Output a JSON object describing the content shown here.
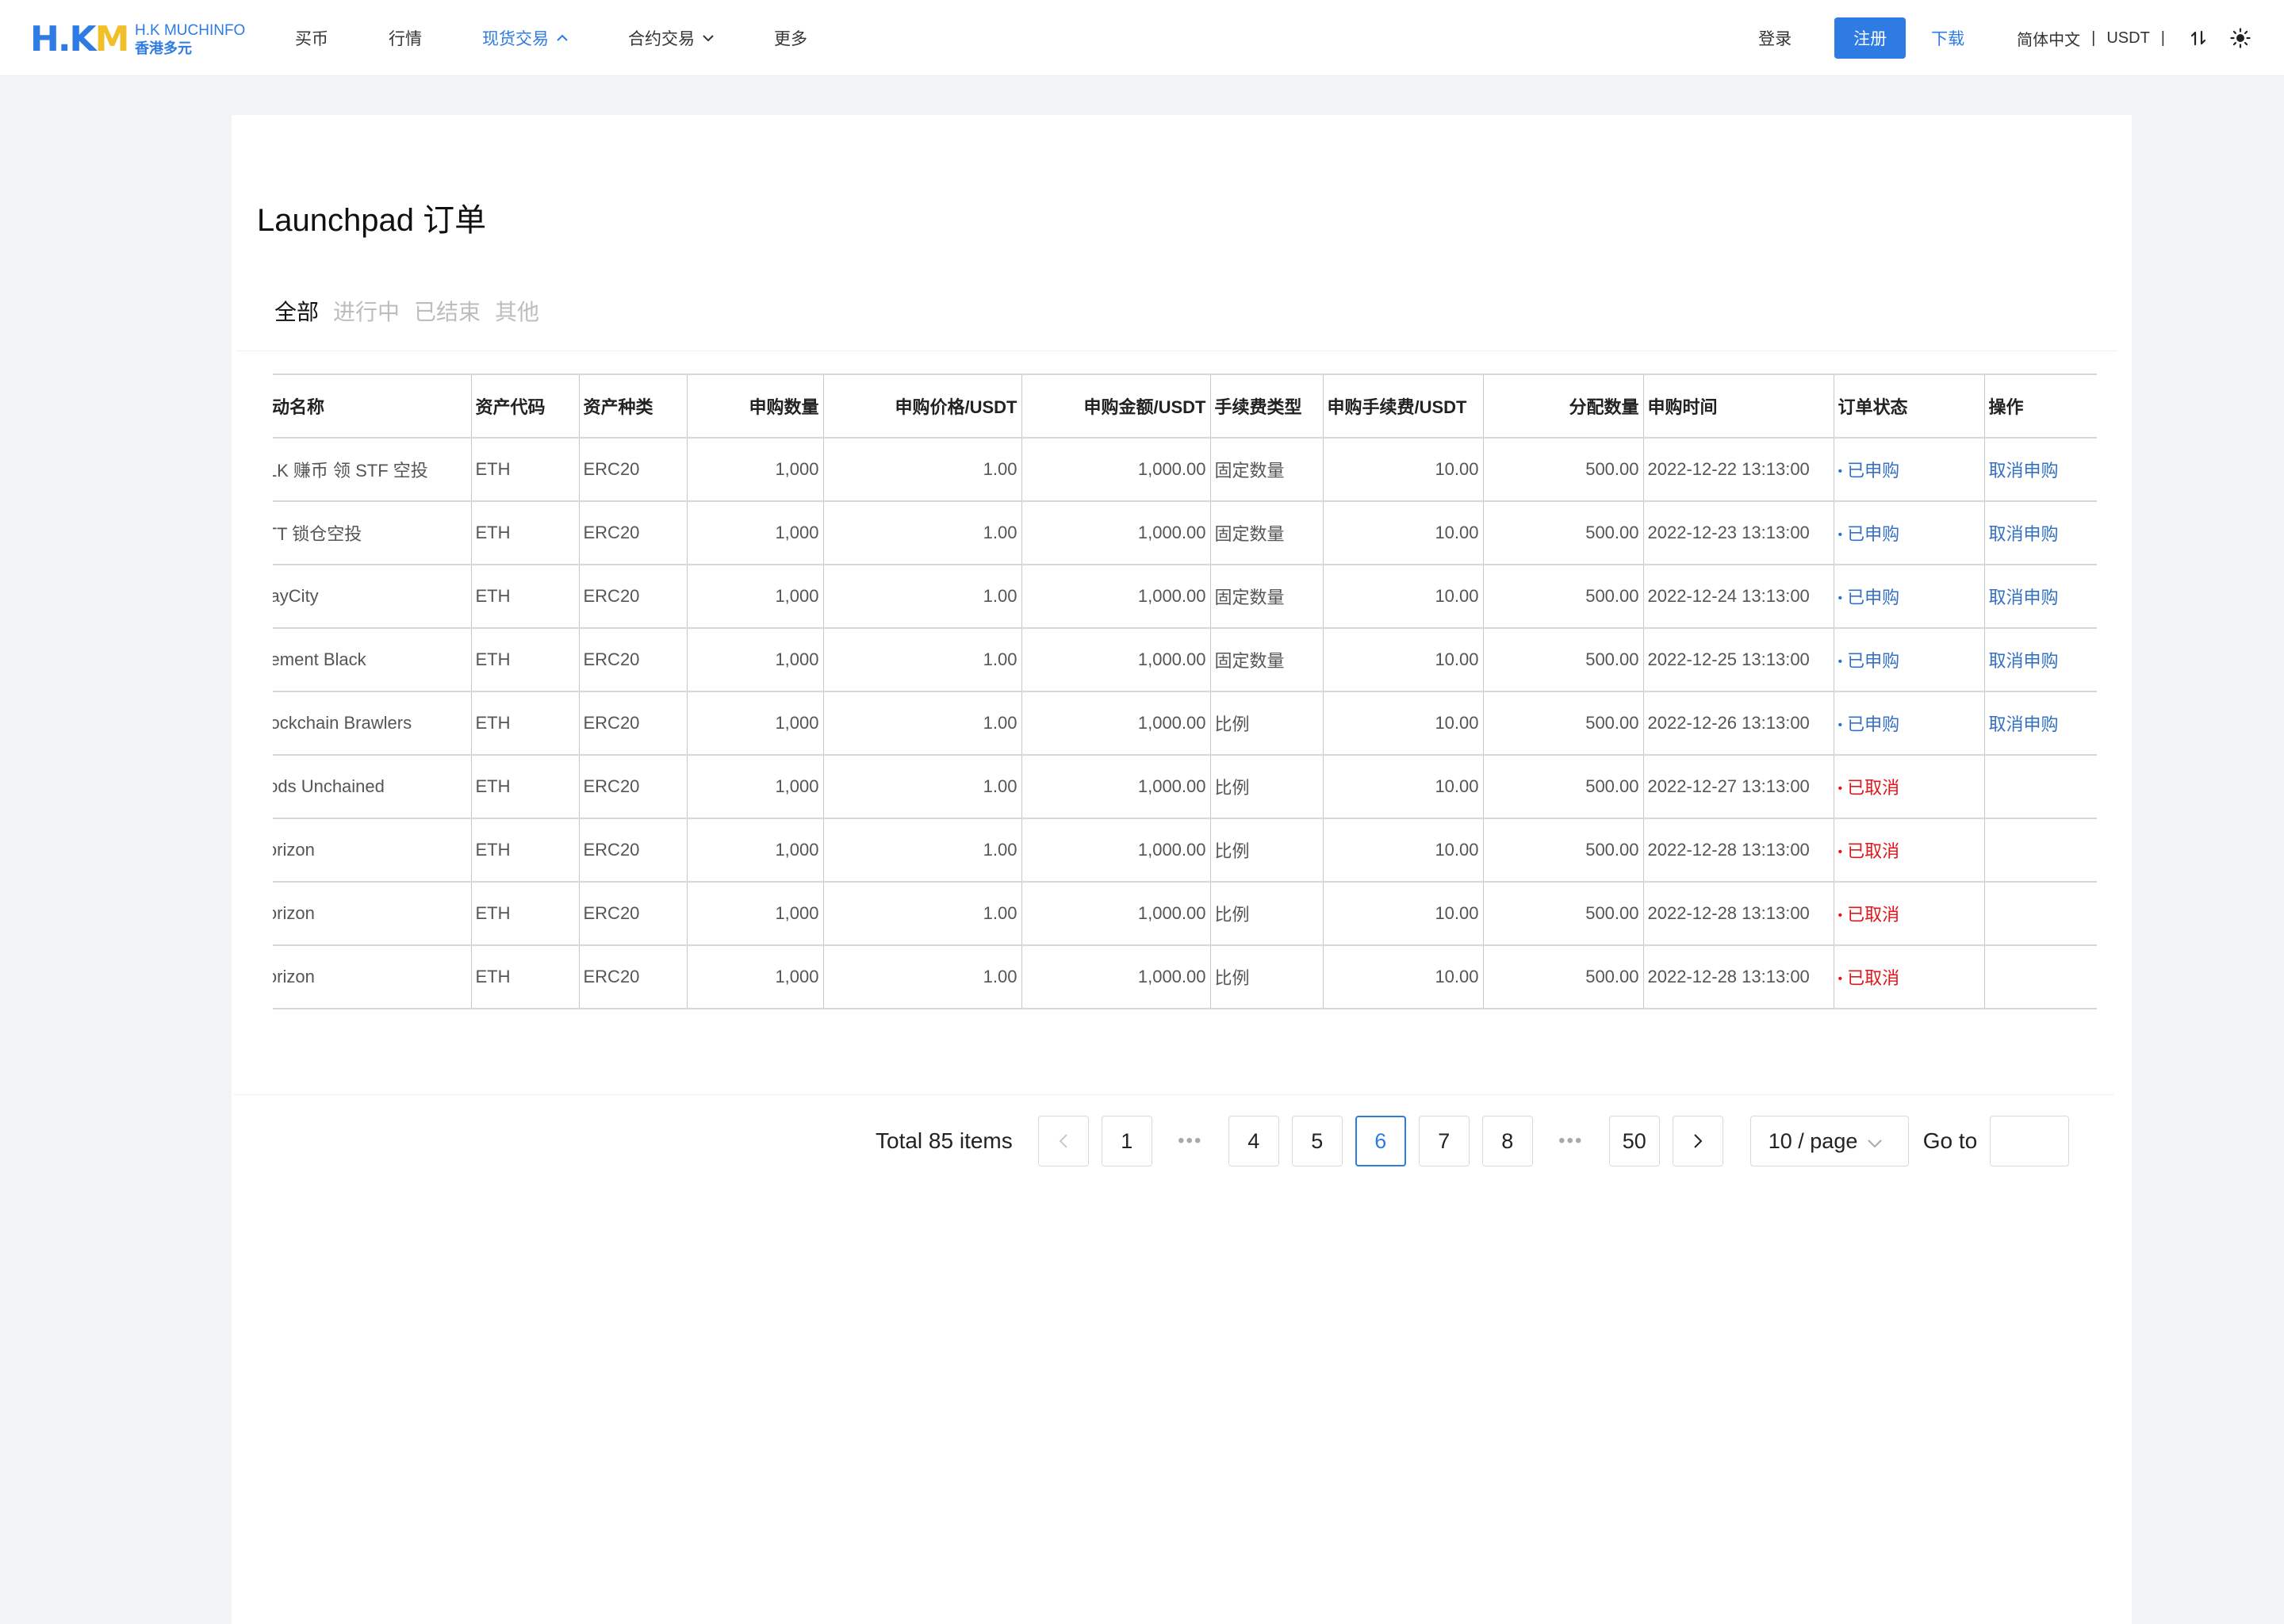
{
  "brand": {
    "mark_left": "H.K",
    "mark_right": "M",
    "name": "H.K MUCHINFO",
    "sub": "香港多元"
  },
  "nav": {
    "items": [
      {
        "label": "买币"
      },
      {
        "label": "行情"
      },
      {
        "label": "现货交易"
      },
      {
        "label": "合约交易"
      },
      {
        "label": "更多"
      }
    ],
    "login": "登录",
    "register": "注册",
    "download": "下载",
    "language": "简体中文",
    "currency": "USDT",
    "separator": "|"
  },
  "page": {
    "title": "Launchpad 订单"
  },
  "tabs": [
    {
      "label": "全部"
    },
    {
      "label": "进行中"
    },
    {
      "label": "已结束"
    },
    {
      "label": "其他"
    }
  ],
  "table": {
    "headers": [
      "活动名称",
      "资产代码",
      "资产种类",
      "申购数量",
      "申购价格/USDT",
      "申购金额/USDT",
      "手续费类型",
      "申购手续费/USDT",
      "分配数量",
      "申购时间",
      "订单状态",
      "操作"
    ],
    "rows": [
      {
        "name": "HLK 赚币 领 STF 空投",
        "code": "ETH",
        "type": "ERC20",
        "qty": "1,000",
        "price": "1.00",
        "amount": "1,000.00",
        "fee_type": "固定数量",
        "fee": "10.00",
        "alloc": "500.00",
        "time": "2022-12-22 13:13:00",
        "status": "已申购",
        "status_kind": "on",
        "action": "取消申购"
      },
      {
        "name": "BTT 锁仓空投",
        "code": "ETH",
        "type": "ERC20",
        "qty": "1,000",
        "price": "1.00",
        "amount": "1,000.00",
        "fee_type": "固定数量",
        "fee": "10.00",
        "alloc": "500.00",
        "time": "2022-12-23 13:13:00",
        "status": "已申购",
        "status_kind": "on",
        "action": "取消申购"
      },
      {
        "name": "PlayCity",
        "code": "ETH",
        "type": "ERC20",
        "qty": "1,000",
        "price": "1.00",
        "amount": "1,000.00",
        "fee_type": "固定数量",
        "fee": "10.00",
        "alloc": "500.00",
        "time": "2022-12-24 13:13:00",
        "status": "已申购",
        "status_kind": "on",
        "action": "取消申购"
      },
      {
        "name": "Element Black",
        "code": "ETH",
        "type": "ERC20",
        "qty": "1,000",
        "price": "1.00",
        "amount": "1,000.00",
        "fee_type": "固定数量",
        "fee": "10.00",
        "alloc": "500.00",
        "time": "2022-12-25 13:13:00",
        "status": "已申购",
        "status_kind": "on",
        "action": "取消申购"
      },
      {
        "name": "Blockchain Brawlers",
        "code": "ETH",
        "type": "ERC20",
        "qty": "1,000",
        "price": "1.00",
        "amount": "1,000.00",
        "fee_type": "比例",
        "fee": "10.00",
        "alloc": "500.00",
        "time": "2022-12-26 13:13:00",
        "status": "已申购",
        "status_kind": "on",
        "action": "取消申购"
      },
      {
        "name": "Gods Unchained",
        "code": "ETH",
        "type": "ERC20",
        "qty": "1,000",
        "price": "1.00",
        "amount": "1,000.00",
        "fee_type": "比例",
        "fee": "10.00",
        "alloc": "500.00",
        "time": "2022-12-27 13:13:00",
        "status": "已取消",
        "status_kind": "off",
        "action": ""
      },
      {
        "name": "Horizon",
        "code": "ETH",
        "type": "ERC20",
        "qty": "1,000",
        "price": "1.00",
        "amount": "1,000.00",
        "fee_type": "比例",
        "fee": "10.00",
        "alloc": "500.00",
        "time": "2022-12-28 13:13:00",
        "status": "已取消",
        "status_kind": "off",
        "action": ""
      },
      {
        "name": "Horizon",
        "code": "ETH",
        "type": "ERC20",
        "qty": "1,000",
        "price": "1.00",
        "amount": "1,000.00",
        "fee_type": "比例",
        "fee": "10.00",
        "alloc": "500.00",
        "time": "2022-12-28 13:13:00",
        "status": "已取消",
        "status_kind": "off",
        "action": ""
      },
      {
        "name": "Horizon",
        "code": "ETH",
        "type": "ERC20",
        "qty": "1,000",
        "price": "1.00",
        "amount": "1,000.00",
        "fee_type": "比例",
        "fee": "10.00",
        "alloc": "500.00",
        "time": "2022-12-28 13:13:00",
        "status": "已取消",
        "status_kind": "off",
        "action": ""
      }
    ]
  },
  "pagination": {
    "total": "Total 85 items",
    "prev": "<",
    "next": ">",
    "pages": [
      "1",
      "•••",
      "4",
      "5",
      "6",
      "7",
      "8",
      "•••",
      "50"
    ],
    "current": "6",
    "page_size": "10 / page",
    "goto_label": "Go to",
    "goto_value": ""
  },
  "colors": {
    "accent": "#2d7be3",
    "logo_yellow": "#f0bf2a",
    "status_subscribed": "#3470c2",
    "status_cancelled": "#e3131a",
    "page_bg": "#f1f4f7"
  }
}
